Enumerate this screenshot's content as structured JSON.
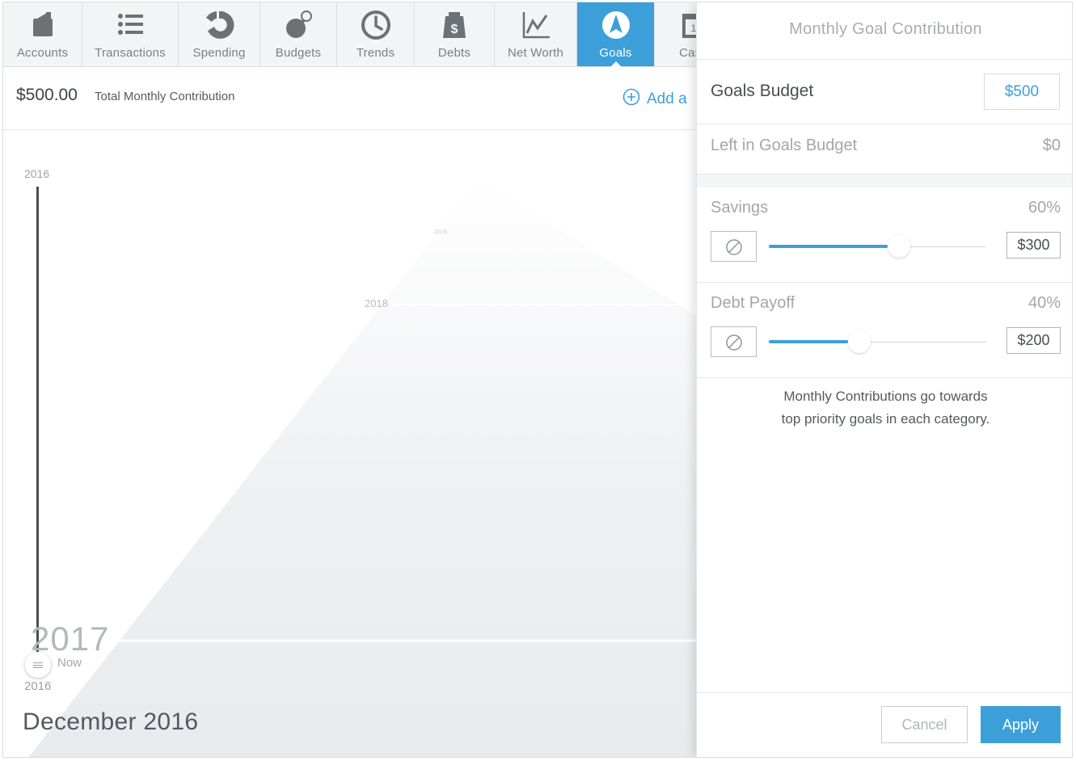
{
  "nav": {
    "tabs": [
      {
        "label": "Accounts",
        "icon": "wallet-icon",
        "active": false
      },
      {
        "label": "Transactions",
        "icon": "list-icon",
        "active": false
      },
      {
        "label": "Spending",
        "icon": "pie-chart-icon",
        "active": false
      },
      {
        "label": "Budgets",
        "icon": "bomb-icon",
        "active": false
      },
      {
        "label": "Trends",
        "icon": "clock-icon",
        "active": false
      },
      {
        "label": "Debts",
        "icon": "weight-dollar-icon",
        "active": false
      },
      {
        "label": "Net Worth",
        "icon": "line-chart-icon",
        "active": false
      },
      {
        "label": "Goals",
        "icon": "compass-icon",
        "active": true
      },
      {
        "label": "Cash",
        "icon": "calendar-icon",
        "active": false
      }
    ],
    "accent_color": "#3d9fd9"
  },
  "summary": {
    "total_amount": "$500.00",
    "total_label": "Total Monthly Contribution",
    "add_label": "Add a"
  },
  "timeline": {
    "year_top": "2016",
    "year_2019": "2019",
    "year_2018": "2018",
    "year_2017": "2017",
    "now_label": "Now",
    "year_bottom": "2016",
    "month_title": "December 2016"
  },
  "panel": {
    "title": "Monthly Goal Contribution",
    "goals_budget_label": "Goals Budget",
    "goals_budget_value": "$500",
    "left_label": "Left in Goals Budget",
    "left_value": "$0",
    "categories": [
      {
        "name": "Savings",
        "percent": "60%",
        "amount": "$300",
        "share": 0.6
      },
      {
        "name": "Debt Payoff",
        "percent": "40%",
        "amount": "$200",
        "share": 0.4
      }
    ],
    "note_line1": "Monthly Contributions go towards",
    "note_line2": "top priority goals in each category.",
    "cancel_label": "Cancel",
    "apply_label": "Apply"
  }
}
